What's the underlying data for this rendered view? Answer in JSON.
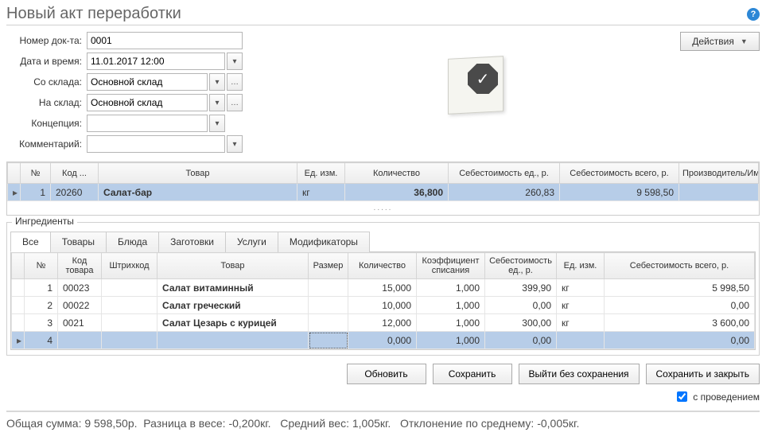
{
  "title": "Новый акт переработки",
  "help_icon": "?",
  "actions_label": "Действия",
  "form": {
    "doc_no_label": "Номер док-та:",
    "doc_no_value": "0001",
    "datetime_label": "Дата и время:",
    "datetime_value": "11.01.2017 12:00",
    "from_stock_label": "Со склада:",
    "from_stock_value": "Основной склад",
    "to_stock_label": "На склад:",
    "to_stock_value": "Основной склад",
    "concept_label": "Концепция:",
    "concept_value": "",
    "comment_label": "Комментарий:",
    "comment_value": ""
  },
  "products_table": {
    "headers": {
      "indicator": "",
      "no": "№",
      "code": "Код ...",
      "item": "Товар",
      "unit": "Ед. изм.",
      "qty": "Количество",
      "cost_unit": "Себестоимость ед., р.",
      "cost_total": "Себестоимость всего, р.",
      "producer": "Производитель/Им..."
    },
    "rows": [
      {
        "indicator": "▸",
        "no": "1",
        "code": "20260",
        "item": "Салат-бар",
        "unit": "кг",
        "qty": "36,800",
        "cost_unit": "260,83",
        "cost_total": "9 598,50",
        "producer": ""
      }
    ],
    "ellipsis": "....."
  },
  "ingredients": {
    "legend": "Ингредиенты",
    "tabs": [
      "Все",
      "Товары",
      "Блюда",
      "Заготовки",
      "Услуги",
      "Модификаторы"
    ],
    "active_tab_index": 0,
    "headers": {
      "indicator": "",
      "no": "№",
      "code": "Код товара",
      "barcode": "Штрихкод",
      "item": "Товар",
      "size": "Размер",
      "qty": "Количество",
      "coef": "Коэффициент списания",
      "cost_unit": "Себестоимость ед., р.",
      "unit": "Ед. изм.",
      "cost_total": "Себестоимость всего, р."
    },
    "rows": [
      {
        "indicator": "",
        "no": "1",
        "code": "00023",
        "barcode": "",
        "item": "Салат витаминный",
        "size": "",
        "qty": "15,000",
        "coef": "1,000",
        "cost_unit": "399,90",
        "unit": "кг",
        "cost_total": "5 998,50"
      },
      {
        "indicator": "",
        "no": "2",
        "code": "00022",
        "barcode": "",
        "item": "Салат греческий",
        "size": "",
        "qty": "10,000",
        "coef": "1,000",
        "cost_unit": "0,00",
        "unit": "кг",
        "cost_total": "0,00"
      },
      {
        "indicator": "",
        "no": "3",
        "code": "0021",
        "barcode": "",
        "item": "Салат Цезарь с курицей",
        "size": "",
        "qty": "12,000",
        "coef": "1,000",
        "cost_unit": "300,00",
        "unit": "кг",
        "cost_total": "3 600,00"
      },
      {
        "indicator": "▸",
        "no": "4",
        "code": "",
        "barcode": "",
        "item": "",
        "size": "",
        "qty": "0,000",
        "coef": "1,000",
        "cost_unit": "0,00",
        "unit": "",
        "cost_total": "0,00"
      }
    ]
  },
  "buttons": {
    "refresh": "Обновить",
    "save": "Сохранить",
    "exit_nosave": "Выйти без сохранения",
    "save_close": "Сохранить и закрыть"
  },
  "checkbox": {
    "label": "с проведением",
    "checked": true
  },
  "footer": {
    "total_label": "Общая сумма:",
    "total_value": "9 598,50р.",
    "weight_diff_label": "Разница в весе:",
    "weight_diff_value": "-0,200кг.",
    "avg_weight_label": "Средний вес:",
    "avg_weight_value": "1,005кг.",
    "avg_dev_label": "Отклонение по среднему:",
    "avg_dev_value": "-0,005кг."
  }
}
